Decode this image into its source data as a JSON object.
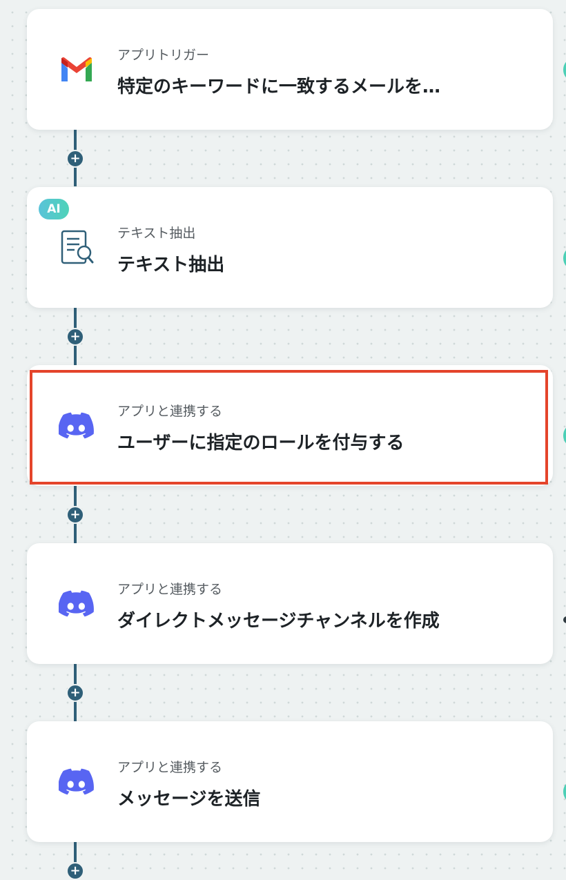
{
  "workflow": {
    "steps": [
      {
        "subtitle": "アプリトリガー",
        "title": "特定のキーワードに一致するメールを…",
        "icon": "gmail-icon",
        "badge": ""
      },
      {
        "subtitle": "テキスト抽出",
        "title": "テキスト抽出",
        "icon": "document-search-icon",
        "badge": "AI"
      },
      {
        "subtitle": "アプリと連携する",
        "title": "ユーザーに指定のロールを付与する",
        "icon": "discord-icon",
        "badge": "",
        "highlighted": true
      },
      {
        "subtitle": "アプリと連携する",
        "title": "ダイレクトメッセージチャンネルを作成",
        "icon": "discord-icon",
        "badge": ""
      },
      {
        "subtitle": "アプリと連携する",
        "title": "メッセージを送信",
        "icon": "discord-icon",
        "badge": ""
      }
    ],
    "add_step_label": "+"
  },
  "colors": {
    "connector": "#2f5f78",
    "highlight": "#e4442b",
    "discord": "#5865f2",
    "ai_badge": "#4fc6cf",
    "background": "#eef2f2"
  }
}
